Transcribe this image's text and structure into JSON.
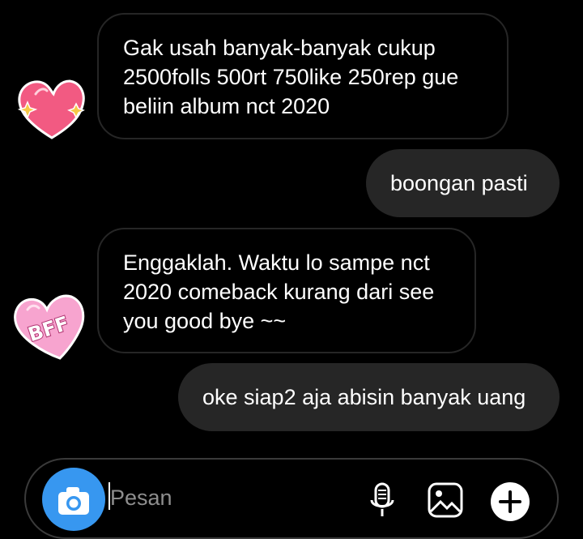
{
  "messages": [
    {
      "direction": "incoming",
      "text": "Gak usah banyak-banyak cukup 2500folls 500rt 750like 250rep gue beliin album nct 2020"
    },
    {
      "direction": "outgoing",
      "text": "boongan pasti"
    },
    {
      "direction": "incoming",
      "text": "Enggaklah. Waktu lo sampe nct 2020 comeback kurang dari see you good bye ~~"
    },
    {
      "direction": "outgoing",
      "text": "oke siap2 aja abisin banyak uang"
    }
  ],
  "stickers": {
    "heart_sparkle": {
      "icon": "heart-sparkle-sticker",
      "color": "#f25a82"
    },
    "bff_heart": {
      "icon": "bff-heart-sticker",
      "color": "#f7a4cf",
      "text": "BFF"
    }
  },
  "composer": {
    "placeholder": "Pesan",
    "camera_icon": "camera-icon",
    "mic_icon": "microphone-icon",
    "gallery_icon": "image-icon",
    "more_icon": "plus-circle-icon"
  },
  "colors": {
    "background": "#000000",
    "incoming_border": "#262626",
    "outgoing_bubble": "#262626",
    "accent": "#3797f0"
  }
}
